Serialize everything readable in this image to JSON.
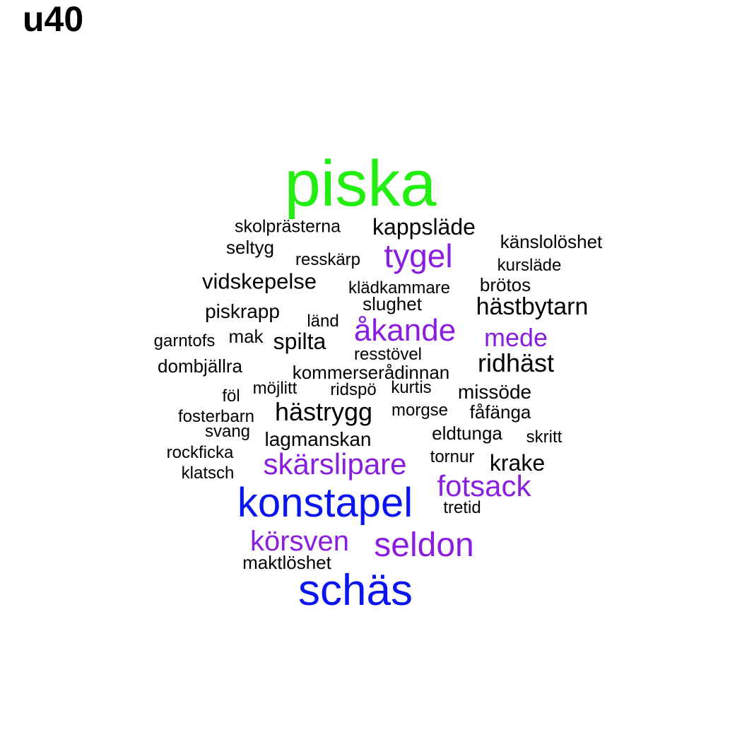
{
  "panel_label": "u40",
  "colors": {
    "green": "#22ee11",
    "blue": "#0a14ee",
    "purple": "#8a1ee0",
    "black": "#000000"
  },
  "words": [
    {
      "text": "piska",
      "color": "green"
    },
    {
      "text": "konstapel",
      "color": "blue"
    },
    {
      "text": "schäs",
      "color": "blue"
    },
    {
      "text": "seldon",
      "color": "purple"
    },
    {
      "text": "körsven",
      "color": "purple"
    },
    {
      "text": "skärslipare",
      "color": "purple"
    },
    {
      "text": "fotsack",
      "color": "purple"
    },
    {
      "text": "åkande",
      "color": "purple"
    },
    {
      "text": "tygel",
      "color": "purple"
    },
    {
      "text": "mede",
      "color": "purple"
    },
    {
      "text": "kappsläde",
      "color": "black"
    },
    {
      "text": "skolprästerna",
      "color": "black"
    },
    {
      "text": "känslolöshet",
      "color": "black"
    },
    {
      "text": "seltyg",
      "color": "black"
    },
    {
      "text": "resskärp",
      "color": "black"
    },
    {
      "text": "kursläde",
      "color": "black"
    },
    {
      "text": "vidskepelse",
      "color": "black"
    },
    {
      "text": "klädkammare",
      "color": "black"
    },
    {
      "text": "brötos",
      "color": "black"
    },
    {
      "text": "slughet",
      "color": "black"
    },
    {
      "text": "hästbytarn",
      "color": "black"
    },
    {
      "text": "piskrapp",
      "color": "black"
    },
    {
      "text": "länd",
      "color": "black"
    },
    {
      "text": "garntofs",
      "color": "black"
    },
    {
      "text": "mak",
      "color": "black"
    },
    {
      "text": "spilta",
      "color": "black"
    },
    {
      "text": "resstövel",
      "color": "black"
    },
    {
      "text": "ridhäst",
      "color": "black"
    },
    {
      "text": "dombjällra",
      "color": "black"
    },
    {
      "text": "kommerserådinnan",
      "color": "black"
    },
    {
      "text": "föl",
      "color": "black"
    },
    {
      "text": "möjlitt",
      "color": "black"
    },
    {
      "text": "ridspö",
      "color": "black"
    },
    {
      "text": "kurtis",
      "color": "black"
    },
    {
      "text": "missöde",
      "color": "black"
    },
    {
      "text": "fosterbarn",
      "color": "black"
    },
    {
      "text": "hästrygg",
      "color": "black"
    },
    {
      "text": "morgse",
      "color": "black"
    },
    {
      "text": "fåfänga",
      "color": "black"
    },
    {
      "text": "svang",
      "color": "black"
    },
    {
      "text": "lagmanskan",
      "color": "black"
    },
    {
      "text": "eldtunga",
      "color": "black"
    },
    {
      "text": "skritt",
      "color": "black"
    },
    {
      "text": "rockficka",
      "color": "black"
    },
    {
      "text": "tornur",
      "color": "black"
    },
    {
      "text": "krake",
      "color": "black"
    },
    {
      "text": "klatsch",
      "color": "black"
    },
    {
      "text": "tretid",
      "color": "black"
    },
    {
      "text": "maktlöshet",
      "color": "black"
    }
  ]
}
